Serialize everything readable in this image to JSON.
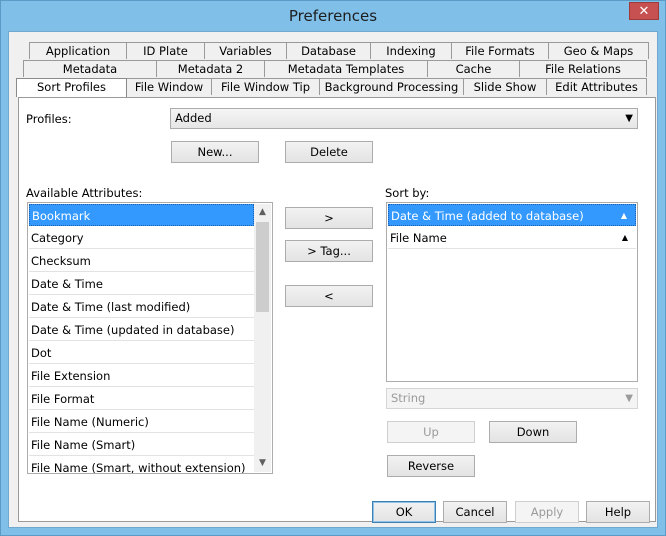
{
  "window": {
    "title": "Preferences",
    "close_glyph": "✕"
  },
  "tabs": {
    "row1": [
      "Application",
      "ID Plate",
      "Variables",
      "Database",
      "Indexing",
      "File Formats",
      "Geo & Maps"
    ],
    "row2": [
      "Metadata",
      "Metadata 2",
      "Metadata Templates",
      "Cache",
      "File Relations"
    ],
    "row3": [
      "Sort Profiles",
      "File Window",
      "File Window Tip",
      "Background Processing",
      "Slide Show",
      "Edit Attributes"
    ],
    "active": "Sort Profiles"
  },
  "profiles": {
    "label": "Profiles:",
    "selected": "Added",
    "new_label": "New...",
    "delete_label": "Delete"
  },
  "available": {
    "label": "Available Attributes:",
    "items": [
      "Bookmark",
      "Category",
      "Checksum",
      "Date & Time",
      "Date & Time (last modified)",
      "Date & Time (updated in database)",
      "Dot",
      "File Extension",
      "File Format",
      "File Name (Numeric)",
      "File Name (Smart)",
      "File Name (Smart, without extension)"
    ],
    "selected": "Bookmark"
  },
  "transfer": {
    "add_label": ">",
    "add_tag_label": "> Tag...",
    "remove_label": "<"
  },
  "sortby": {
    "label": "Sort by:",
    "items": [
      "Date & Time (added to database)",
      "File Name"
    ],
    "selected": "Date & Time (added to database)",
    "type_value": "String",
    "up_label": "Up",
    "down_label": "Down",
    "reverse_label": "Reverse"
  },
  "footer": {
    "ok_label": "OK",
    "cancel_label": "Cancel",
    "apply_label": "Apply",
    "help_label": "Help"
  },
  "icons": {
    "dropdown": "chevron-down-icon",
    "sort": "sort-ascending-icon"
  }
}
